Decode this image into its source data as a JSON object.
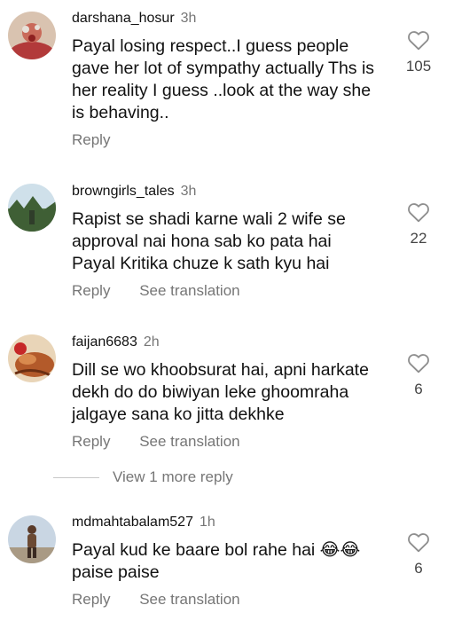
{
  "comments": [
    {
      "username": "darshana_hosur",
      "time": "3h",
      "text": "Payal losing respect..I guess people gave her lot of sympathy actually Ths is her reality I guess ..look at the way she is behaving..",
      "likes": "105",
      "actions": [
        "Reply"
      ]
    },
    {
      "username": "browngirls_tales",
      "time": "3h",
      "text": "Rapist se shadi karne wali 2 wife se approval nai hona sab ko pata hai Payal Kritika chuze k sath kyu hai",
      "likes": "22",
      "actions": [
        "Reply",
        "See translation"
      ]
    },
    {
      "username": "faijan6683",
      "time": "2h",
      "text": "Dill se wo khoobsurat hai, apni harkate dekh do do biwiyan leke ghoomraha jalgaye sana ko jitta dekhke",
      "likes": "6",
      "actions": [
        "Reply",
        "See translation"
      ]
    },
    {
      "username": "mdmahtabalam527",
      "time": "1h",
      "text": "Payal kud ke baare bol rahe hai 😂😂 paise paise",
      "likes": "6",
      "actions": [
        "Reply",
        "See translation"
      ]
    }
  ],
  "view_more_replies": "View 1 more reply",
  "icons": {
    "like": "heart-outline-icon"
  }
}
